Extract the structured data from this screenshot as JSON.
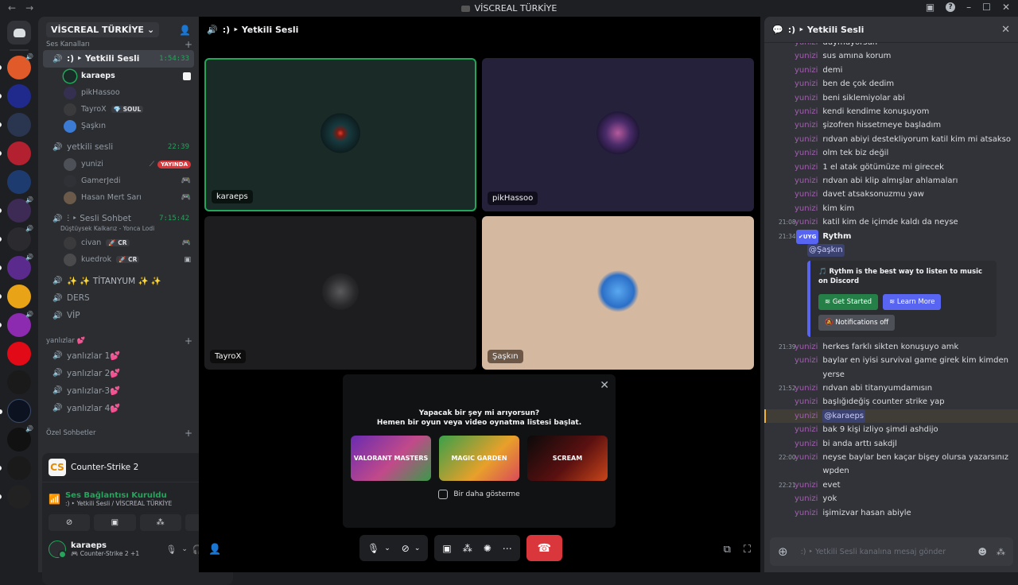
{
  "window": {
    "title": "VİSCREAL TÜRKİYE"
  },
  "server": {
    "name": "VİSCREAL TÜRKİYE",
    "categories": {
      "voice": "Ses Kanalları",
      "yanlizlar": "yanlızlar 💕",
      "private": "Özel Sohbetler"
    },
    "channels": [
      {
        "name": ":) ‣ Yetkili Sesli",
        "timer": "1:54:33",
        "active": true
      },
      {
        "name": "yetkili sesli",
        "timer": "22:39"
      },
      {
        "name": "ⵗ ‣ Sesli Sohbet",
        "timer": "7:15:42",
        "status": "Düştüysek Kalkarız - Yonca Lodi"
      },
      {
        "name": "✨ ✨ TİTANYUM ✨ ✨"
      },
      {
        "name": "DERS"
      },
      {
        "name": "VİP"
      },
      {
        "name": "yanlızlar 1💕"
      },
      {
        "name": "yanlızlar 2💕"
      },
      {
        "name": "yanlızlar-3💕"
      },
      {
        "name": "yanlızlar 4💕"
      }
    ],
    "users_ch1": [
      {
        "name": "karaeps"
      },
      {
        "name": "pikHassoo"
      },
      {
        "name": "TayroX",
        "tag": "SOUL"
      },
      {
        "name": "Şaşkın"
      }
    ],
    "users_ch2": [
      {
        "name": "yunizi",
        "badge": "YAYINDA"
      },
      {
        "name": "GamerJedi"
      },
      {
        "name": "Hasan Mert Sarı"
      }
    ],
    "users_ch3": [
      {
        "name": "civan",
        "tag": "CR"
      },
      {
        "name": "kuedrok",
        "tag": "CR"
      }
    ]
  },
  "game_panel": {
    "game": "Counter-Strike 2",
    "conn_title": "Ses Bağlantısı Kuruldu",
    "conn_sub": ":) ‣ Yetkili Sesli / VİSCREAL TÜRKİYE",
    "user": "karaeps",
    "user_activity": "Counter-Strike 2",
    "user_extra": "+1"
  },
  "stage": {
    "channel": ":) ‣ Yetkili Sesli",
    "tiles": [
      "karaeps",
      "pikHassoo",
      "TayroX",
      "Şaşkın"
    ],
    "promo": {
      "h1": "Yapacak bir şey mi arıyorsun?",
      "h2": "Hemen bir oyun veya video oynatma listesi başlat.",
      "cards": [
        "VALORANT MASTERS",
        "MAGIC GARDEN",
        "SCREAM"
      ],
      "checkbox": "Bir daha gösterme"
    }
  },
  "chat": {
    "title": ":) ‣ Yetkili Sesli",
    "top_cut": "duymuyorsun",
    "author": "yunizi",
    "messages_a": [
      {
        "ts": "",
        "text": "sus amına korum"
      },
      {
        "ts": "",
        "text": "demi"
      },
      {
        "ts": "",
        "text": "ben de çok dedim"
      },
      {
        "ts": "",
        "text": "beni siklemiyolar abi"
      },
      {
        "ts": "",
        "text": "kendi kendime konuşuyom"
      },
      {
        "ts": "",
        "text": "şizofren hissetmeye başladım"
      },
      {
        "ts": "",
        "text": "rıdvan abiyi destekliyorum katil kim mi atsakso"
      },
      {
        "ts": "",
        "text": "olm tek biz değil"
      },
      {
        "ts": "",
        "text": "1 el atak götümüze mi girecek"
      },
      {
        "ts": "",
        "text": "rıdvan abi klip almışlar ahlamaları"
      },
      {
        "ts": "",
        "text": "davet atsaksonuzmu yaw"
      },
      {
        "ts": "",
        "text": "kim kim"
      },
      {
        "ts": "21:08",
        "text": "katil kim de içimde kaldı da neyse"
      }
    ],
    "rythm": {
      "ts": "21:34",
      "badge": "✔UYG",
      "name": "Rythm",
      "mention": "@Şaşkın",
      "embed_title": "🎵 Rythm is the best way to listen to music on Discord",
      "btn_start": "Get Started",
      "btn_more": "Learn More",
      "btn_notif": "Notifications off"
    },
    "messages_b": [
      {
        "ts": "21:39",
        "text": "herkes farklı sikten konuşuyo amk"
      },
      {
        "ts": "",
        "text": "baylar en iyisi survival game girek kim kimden yerse"
      },
      {
        "ts": "21:52",
        "text": "rıdvan abi titanyumdamısın"
      },
      {
        "ts": "",
        "text": "başlığıdeğiş counter strike yap"
      }
    ],
    "mention_msg": "@karaeps",
    "messages_c": [
      {
        "ts": "",
        "text": "bak 9 kişi izliyo şimdi ashdijo"
      },
      {
        "ts": "",
        "text": "bi anda arttı sakdjl"
      },
      {
        "ts": "22:00",
        "text": "neyse baylar ben kaçar bişey olursa yazarsınız wpden"
      },
      {
        "ts": "22:21",
        "text": "evet"
      },
      {
        "ts": "",
        "text": "yok"
      },
      {
        "ts": "",
        "text": "işimizvar hasan abiyle"
      }
    ],
    "composer_placeholder": ":) ‣ Yetkili Sesli kanalına mesaj gönder"
  },
  "colors": {
    "accent": "#5865f2",
    "green": "#23a55a",
    "red": "#da373c"
  }
}
